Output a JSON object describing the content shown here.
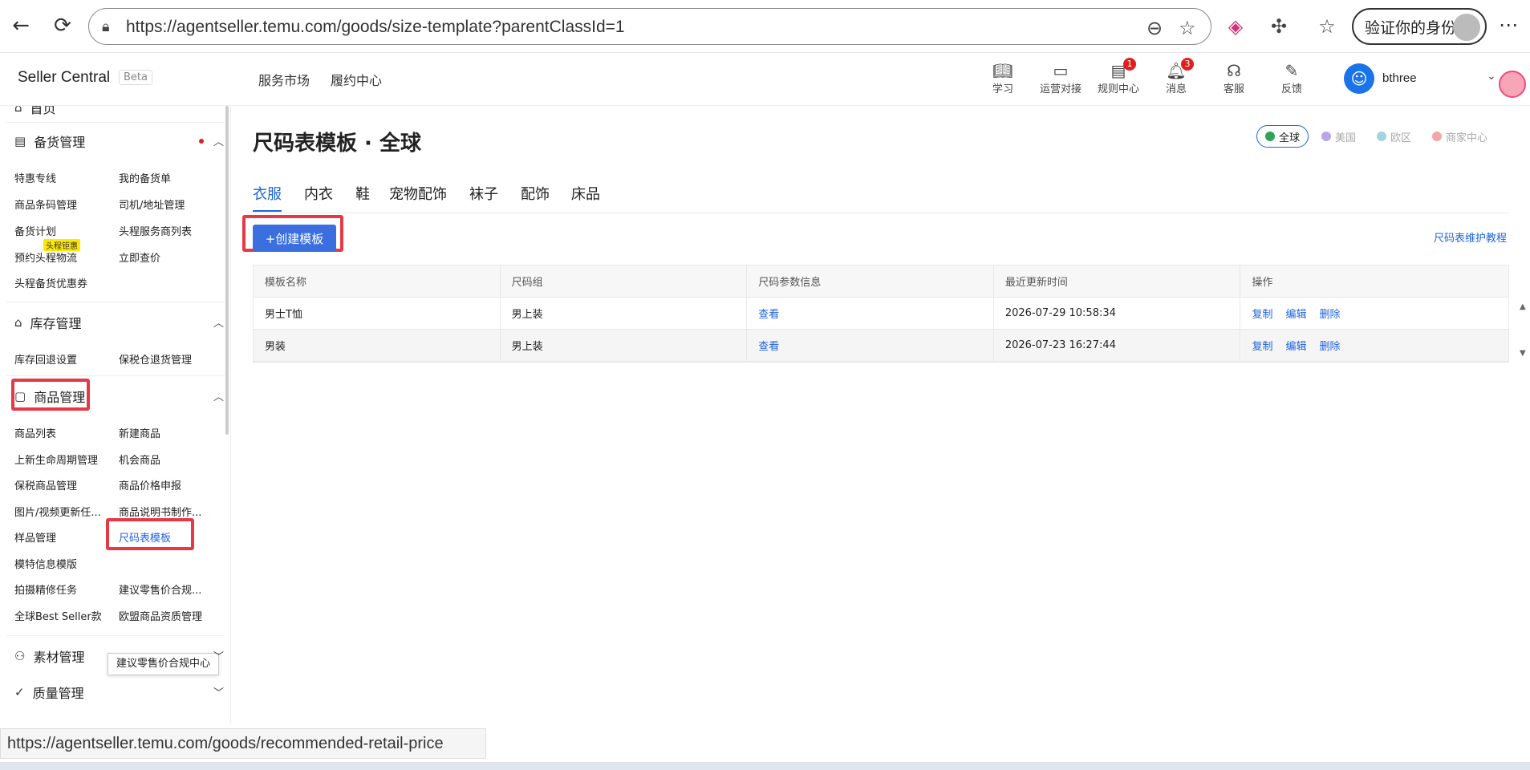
{
  "browser": {
    "url": "https://agentseller.temu.com/goods/size-template?parentClassId=1",
    "verify_label": "验证你的身份",
    "status_url": "https://agentseller.temu.com/goods/recommended-retail-price"
  },
  "header": {
    "brand": "Seller Central",
    "beta": "Beta",
    "nav": [
      "服务市场",
      "履约中心"
    ],
    "tools": [
      {
        "label": "学习",
        "icon": "book-icon"
      },
      {
        "label": "运营对接",
        "icon": "chat-icon"
      },
      {
        "label": "规则中心",
        "icon": "rules-icon",
        "badge": "1"
      },
      {
        "label": "消息",
        "icon": "bell-icon",
        "badge": "3"
      },
      {
        "label": "客服",
        "icon": "headset-icon"
      },
      {
        "label": "反馈",
        "icon": "feedback-icon"
      }
    ],
    "user_name": "bthree"
  },
  "sidebar": {
    "partial_top": "首页",
    "sec1": {
      "title": "备货管理",
      "items": [
        "特惠专线",
        "我的备货单",
        "商品条码管理",
        "司机/地址管理",
        "备货计划",
        "头程服务商列表",
        "预约头程物流",
        "立即查价",
        "头程备货优惠券"
      ],
      "tag": "头程钜惠"
    },
    "sec2": {
      "title": "库存管理",
      "items": [
        "库存回退设置",
        "保税仓退货管理"
      ]
    },
    "sec3": {
      "title": "商品管理",
      "items": [
        "商品列表",
        "新建商品",
        "上新生命周期管理",
        "机会商品",
        "保税商品管理",
        "商品价格申报",
        "图片/视频更新任...",
        "商品说明书制作...",
        "样品管理",
        "尺码表模板",
        "模特信息模版",
        "拍摄精修任务",
        "建议零售价合规...",
        "全球Best Seller款",
        "欧盟商品资质管理"
      ]
    },
    "tooltip": "建议零售价合规中心",
    "sec4": {
      "title": "素材管理"
    },
    "sec5": {
      "title": "质量管理"
    }
  },
  "main": {
    "title": "尺码表模板 · 全球",
    "regions": [
      "全球",
      "美国",
      "欧区",
      "商家中心"
    ],
    "tabs": [
      "衣服",
      "内衣",
      "鞋",
      "宠物配饰",
      "袜子",
      "配饰",
      "床品"
    ],
    "create_label": "+创建模板",
    "help_link": "尺码表维护教程",
    "table": {
      "headers": [
        "模板名称",
        "尺码组",
        "尺码参数信息",
        "最近更新时间",
        "操作"
      ],
      "rows": [
        {
          "name": "男士T恤",
          "group": "男上装",
          "info": "查看",
          "time": "2026-07-29 10:58:34"
        },
        {
          "name": "男装",
          "group": "男上装",
          "info": "查看",
          "time": "2026-07-23 16:27:44"
        }
      ],
      "actions": [
        "复制",
        "编辑",
        "删除"
      ]
    }
  },
  "colors": {
    "accent": "#1e64e0",
    "highlight": "#e63946",
    "button": "#3b6fe0"
  }
}
